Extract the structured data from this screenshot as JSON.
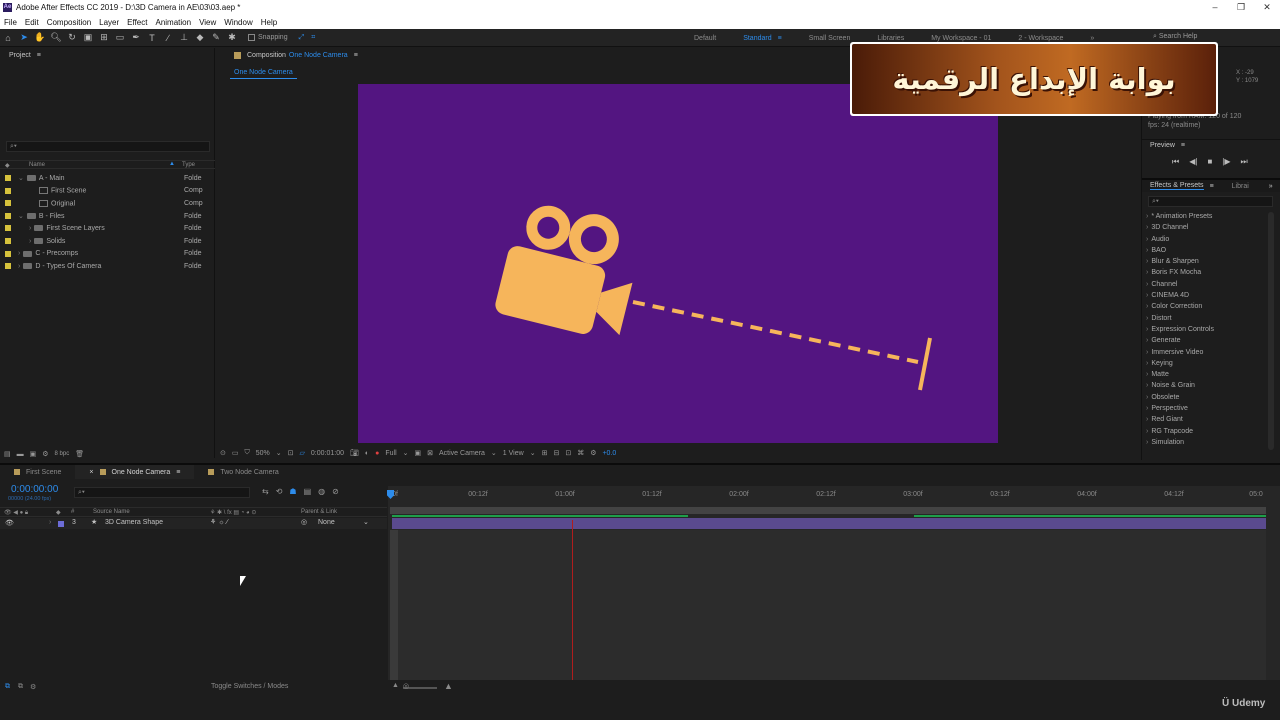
{
  "window": {
    "title": "Adobe After Effects CC 2019 - D:\\3D Camera in AE\\03\\03.aep *",
    "minimize": "–",
    "maximize": "❐",
    "close": "✕"
  },
  "menu": [
    "File",
    "Edit",
    "Composition",
    "Layer",
    "Effect",
    "Animation",
    "View",
    "Window",
    "Help"
  ],
  "toolbar": {
    "snapping": "Snapping",
    "workspaces": [
      "Default",
      "Standard",
      "Small Screen",
      "Libraries",
      "My Workspace - 01",
      "2 - Workspace"
    ],
    "active_workspace": "Standard",
    "more": "»",
    "search_help": "Search Help"
  },
  "project": {
    "title": "Project",
    "menu_icon": "≡",
    "search_placeholder": "⌕▾",
    "col_name": "Name",
    "col_type": "Type",
    "items": [
      {
        "name": "A - Main",
        "type": "Folde",
        "indent": 0,
        "kind": "folder",
        "color": "#d6c23c"
      },
      {
        "name": "First Scene",
        "type": "Comp",
        "indent": 1,
        "kind": "comp",
        "color": "#d6c23c"
      },
      {
        "name": "Original",
        "type": "Comp",
        "indent": 1,
        "kind": "comp",
        "color": "#d6c23c"
      },
      {
        "name": "B - Files",
        "type": "Folde",
        "indent": 0,
        "kind": "folder",
        "color": "#d6c23c"
      },
      {
        "name": "First Scene Layers",
        "type": "Folde",
        "indent": 1,
        "kind": "folder",
        "color": "#d6c23c"
      },
      {
        "name": "Solids",
        "type": "Folde",
        "indent": 1,
        "kind": "folder",
        "color": "#d6c23c"
      },
      {
        "name": "C - Precomps",
        "type": "Folde",
        "indent": 0,
        "kind": "folder",
        "color": "#d6c23c"
      },
      {
        "name": "D - Types Of Camera",
        "type": "Folde",
        "indent": 0,
        "kind": "folder",
        "color": "#d6c23c"
      }
    ],
    "bpc": "8 bpc"
  },
  "composition": {
    "panel_label": "Composition",
    "comp_name": "One Node Camera",
    "tab": "One Node Camera",
    "bg_color": "#531581",
    "camera_color": "#f6b55b",
    "zoom": "50%",
    "time": "0:00:01:00",
    "resolution": "Full",
    "view": "Active Camera",
    "views": "1 View",
    "exposure": "+0.0"
  },
  "info": {
    "x": "X : -29",
    "y": "Y : 1079",
    "playing": "Playing from RAM: 120 of 120",
    "fps": "fps: 24 (realtime)"
  },
  "preview": {
    "title": "Preview",
    "controls": [
      "⏮",
      "◀|",
      "■",
      "|▶",
      "⏭"
    ]
  },
  "effects": {
    "title": "Effects & Presets",
    "libraries": "Librai",
    "more": "»",
    "search_placeholder": "⌕▾",
    "items": [
      "* Animation Presets",
      "3D Channel",
      "Audio",
      "BAO",
      "Blur & Sharpen",
      "Boris FX Mocha",
      "Channel",
      "CINEMA 4D",
      "Color Correction",
      "Distort",
      "Expression Controls",
      "Generate",
      "Immersive Video",
      "Keying",
      "Matte",
      "Noise & Grain",
      "Obsolete",
      "Perspective",
      "Red Giant",
      "RG Trapcode",
      "Simulation"
    ]
  },
  "timeline": {
    "tabs": [
      {
        "label": "First Scene",
        "active": false
      },
      {
        "label": "One Node Camera",
        "active": true
      },
      {
        "label": "Two Node Camera",
        "active": false
      }
    ],
    "timecode": "0:00:00:00",
    "fps": "00000 (24.00 fps)",
    "search_placeholder": "⌕▾",
    "col_source": "Source Name",
    "col_parent": "Parent & Link",
    "layer": {
      "num": "3",
      "name": "3D Camera Shape",
      "parent": "None",
      "color": "#6c6cd6"
    },
    "ruler": [
      "0f",
      "00:12f",
      "01:00f",
      "01:12f",
      "02:00f",
      "02:12f",
      "03:00f",
      "03:12f",
      "04:00f",
      "04:12f",
      "05:0"
    ],
    "toggle": "Toggle Switches / Modes"
  },
  "watermark": {
    "banner_text": "بوابة الإبداع الرقمية",
    "udemy": "Udemy"
  }
}
